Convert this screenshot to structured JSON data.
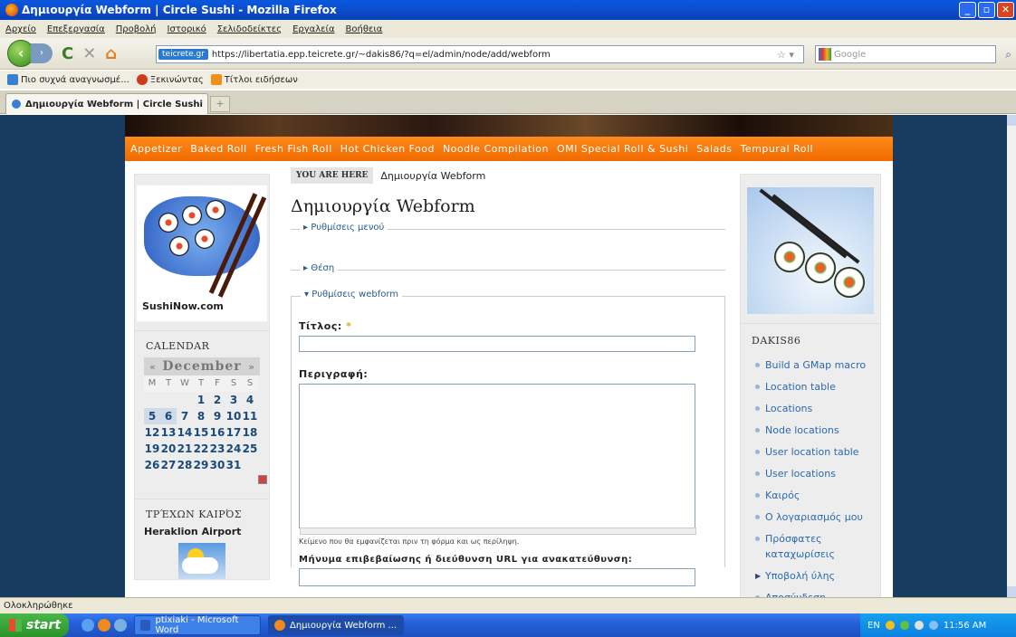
{
  "window": {
    "title": "Δημιουργία Webform | Circle Sushi - Mozilla Firefox"
  },
  "menu": [
    "Αρχείο",
    "Επεξεργασία",
    "Προβολή",
    "Ιστορικό",
    "Σελιδοδείκτες",
    "Εργαλεία",
    "Βοήθεια"
  ],
  "url": {
    "site": "teicrete.gr",
    "address": "https://libertatia.epp.teicrete.gr/~dakis86/?q=el/admin/node/add/webform"
  },
  "search": {
    "placeholder": "Google"
  },
  "bookmarks": [
    "Πιο συχνά αναγνωσμέ...",
    "Ξεκινώντας",
    "Τίτλοι ειδήσεων"
  ],
  "tab": {
    "label": "Δημιουργία Webform | Circle Sushi",
    "new_tab_symbol": "+"
  },
  "site_nav": [
    "Appetizer",
    "Baked Roll",
    "Fresh Fish Roll",
    "Hot Chicken Food",
    "Noodle Compilation",
    "OMI Special Roll & Sushi",
    "Salads",
    "Tempural Roll"
  ],
  "left": {
    "logo_text": "SushiNow.com",
    "calendar_title": "CALENDAR",
    "calendar": {
      "prev": "«",
      "next": "»",
      "month": "December",
      "day_names": [
        "M",
        "T",
        "W",
        "T",
        "F",
        "S",
        "S"
      ],
      "weeks": [
        [
          "",
          "",
          "",
          "1",
          "2",
          "3",
          "4"
        ],
        [
          "5",
          "6",
          "7",
          "8",
          "9",
          "10",
          "11"
        ],
        [
          "12",
          "13",
          "14",
          "15",
          "16",
          "17",
          "18"
        ],
        [
          "19",
          "20",
          "21",
          "22",
          "23",
          "24",
          "25"
        ],
        [
          "26",
          "27",
          "28",
          "29",
          "30",
          "31",
          ""
        ]
      ]
    },
    "weather_title": "ΤΡΈΧΩΝ ΚΑΙΡΌΣ",
    "weather_location": "Heraklion Airport"
  },
  "main": {
    "breadcrumb_label": "YOU ARE HERE",
    "breadcrumb": "Δημιουργία Webform",
    "title": "Δημιουργία Webform",
    "fieldset_menu": "▸ Ρυθμίσεις μενού",
    "fieldset_position": "▸ Θέση",
    "fieldset_webform": "▾ Ρυθμίσεις webform",
    "title_label": "Τίτλος:",
    "required_mark": "*",
    "description_label": "Περιγραφή:",
    "description_help": "Κείμενο που θα εμφανίζεται πριν τη φόρμα και ως περίληψη.",
    "confirmation_label": "Μήνυμα επιβεβαίωσης ή διεύθυνση URL για ανακατεύθυνση:"
  },
  "right": {
    "user_title": "DAKIS86",
    "links": [
      "Build a GMap macro",
      "Location table",
      "Locations",
      "Node locations",
      "User location table",
      "User locations",
      "Καιρός",
      "Ο λογαριασμός μου",
      "Πρόσφατες καταχωρίσεις",
      "Υποβολή ύλης",
      "Αποσύνδεση"
    ]
  },
  "status": "Ολοκληρώθηκε",
  "taskbar": {
    "start": "start",
    "tasks": [
      "ptixiaki - Microsoft Word",
      "Δημιουργία Webform ..."
    ],
    "lang": "EN",
    "clock": "11:56 AM"
  },
  "colors": {
    "accent": "#f47a00",
    "page_bg": "#183c60",
    "link": "#2a6ab0"
  }
}
